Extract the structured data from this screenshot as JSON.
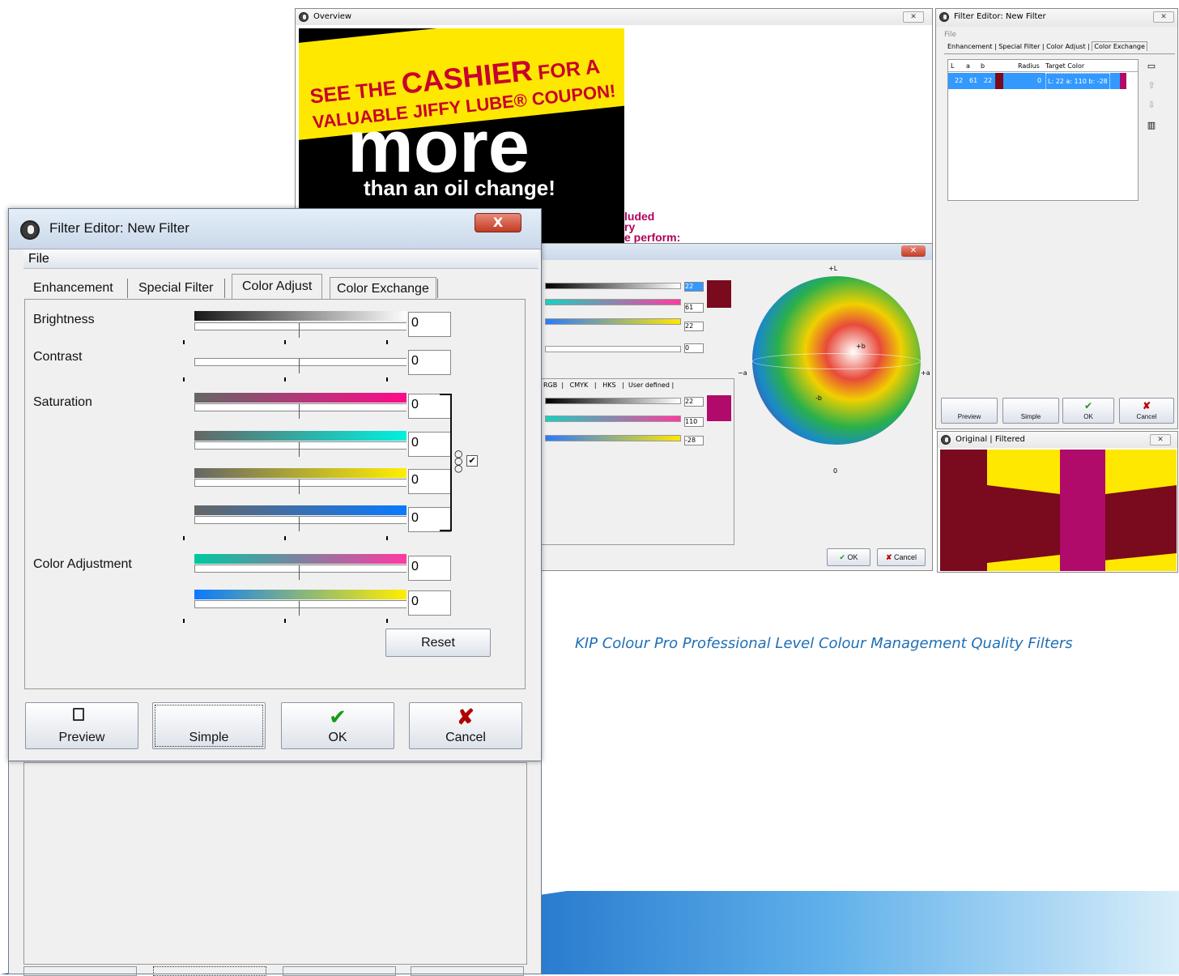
{
  "overview": {
    "title": "Overview",
    "ad": {
      "line1a": "SEE THE ",
      "line1b": "CASHIER",
      "line1c": " FOR A",
      "line2": "VALUABLE JIFFY LUBE® COUPON!",
      "big": "more",
      "sub": "than an oil change!",
      "frag1": "luded",
      "frag2": "ry",
      "frag3": "e perform:"
    }
  },
  "right_editor": {
    "title": "Filter Editor: New Filter",
    "menu": "File",
    "tabs": [
      "Enhancement",
      "Special Filter",
      "Color Adjust",
      "Color Exchange"
    ],
    "columns": [
      "L",
      "a",
      "b",
      "",
      "Radius",
      "Target Color"
    ],
    "row": {
      "L": "22",
      "a": "61",
      "b": "22",
      "radius": "0",
      "target": "L: 22 a: 110 b: -28"
    },
    "buttons": [
      "Preview",
      "Simple",
      "OK",
      "Cancel"
    ]
  },
  "original": {
    "title": "Original | Filtered"
  },
  "picker": {
    "values_top": [
      "22",
      "61",
      "22",
      "0"
    ],
    "tabs": [
      "RGB",
      "CMYK",
      "HKS",
      "User defined"
    ],
    "values_bottom": [
      "22",
      "110",
      "-28"
    ],
    "sphere_labels": {
      "top": "+L",
      "left": "−a",
      "right": "+a",
      "b": "+b",
      "bottom": "0",
      "minus_b": "-b"
    },
    "ok": "OK",
    "cancel": "Cancel"
  },
  "main": {
    "title": "Filter Editor: New Filter",
    "menu": "File",
    "tabs": [
      "Enhancement",
      "Special Filter",
      "Color Adjust",
      "Color Exchange"
    ],
    "labels": {
      "brightness": "Brightness",
      "contrast": "Contrast",
      "saturation": "Saturation",
      "color_adjustment": "Color Adjustment"
    },
    "values": {
      "brightness": "0",
      "contrast": "0",
      "sat1": "0",
      "sat2": "0",
      "sat3": "0",
      "sat4": "0",
      "adj1": "0",
      "adj2": "0"
    },
    "reset": "Reset",
    "buttons": {
      "preview": "Preview",
      "simple": "Simple",
      "ok": "OK",
      "cancel": "Cancel"
    },
    "close": "X"
  },
  "caption": "KIP Colour Pro Professional Level Colour Management Quality Filters",
  "colors": {
    "swatch_dark": "#7a0a1e",
    "swatch_magenta": "#b00a6a",
    "yellow": "#ffef00",
    "accent_blue": "#3a9ad9"
  }
}
